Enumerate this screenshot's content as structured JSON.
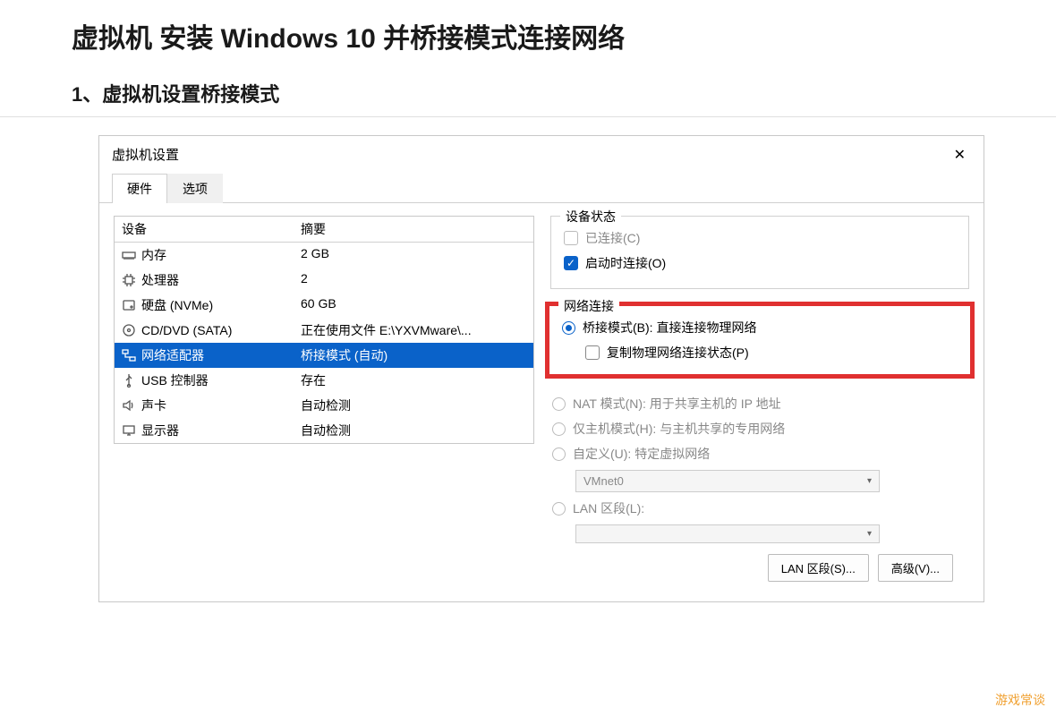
{
  "article": {
    "title": "虚拟机 安装 Windows 10 并桥接模式连接网络",
    "section": "1、虚拟机设置桥接模式"
  },
  "dialog": {
    "title": "虚拟机设置",
    "tabs": {
      "hardware": "硬件",
      "options": "选项"
    },
    "headers": {
      "device": "设备",
      "summary": "摘要"
    },
    "rows": [
      {
        "icon": "ram",
        "device": "内存",
        "summary": "2 GB"
      },
      {
        "icon": "cpu",
        "device": "处理器",
        "summary": "2"
      },
      {
        "icon": "disk",
        "device": "硬盘 (NVMe)",
        "summary": "60 GB"
      },
      {
        "icon": "cd",
        "device": "CD/DVD (SATA)",
        "summary": "正在使用文件 E:\\YXVMware\\..."
      },
      {
        "icon": "net",
        "device": "网络适配器",
        "summary": "桥接模式 (自动)",
        "selected": true
      },
      {
        "icon": "usb",
        "device": "USB 控制器",
        "summary": "存在"
      },
      {
        "icon": "sound",
        "device": "声卡",
        "summary": "自动检测"
      },
      {
        "icon": "display",
        "device": "显示器",
        "summary": "自动检测"
      }
    ],
    "device_status": {
      "title": "设备状态",
      "connected": "已连接(C)",
      "connect_on_start": "启动时连接(O)"
    },
    "net_conn": {
      "title": "网络连接",
      "bridged": "桥接模式(B): 直接连接物理网络",
      "replicate": "复制物理网络连接状态(P)",
      "nat": "NAT 模式(N): 用于共享主机的 IP 地址",
      "hostonly": "仅主机模式(H): 与主机共享的专用网络",
      "custom": "自定义(U): 特定虚拟网络",
      "custom_value": "VMnet0",
      "lan": "LAN 区段(L):",
      "lan_value": ""
    },
    "buttons": {
      "lan_seg": "LAN 区段(S)...",
      "advanced": "高级(V)..."
    }
  },
  "watermark": "游戏常谈"
}
